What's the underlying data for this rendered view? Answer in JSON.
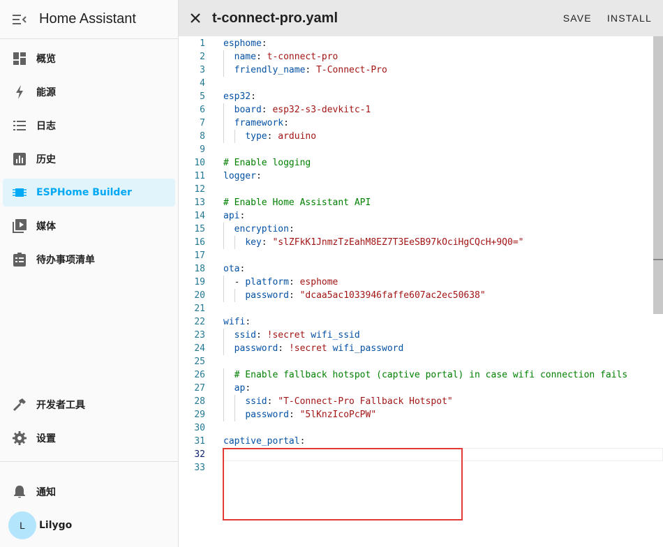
{
  "app": {
    "title": "Home Assistant"
  },
  "sidebar": {
    "items": [
      {
        "label": "概览",
        "icon": "dashboard-icon"
      },
      {
        "label": "能源",
        "icon": "lightning-icon"
      },
      {
        "label": "日志",
        "icon": "list-icon"
      },
      {
        "label": "历史",
        "icon": "chart-icon"
      },
      {
        "label": "ESPHome Builder",
        "icon": "chip-icon",
        "active": true
      },
      {
        "label": "媒体",
        "icon": "play-box-icon"
      },
      {
        "label": "待办事项清单",
        "icon": "clipboard-list-icon"
      }
    ],
    "dev_tools": "开发者工具",
    "settings": "设置",
    "notifications": "通知",
    "user": {
      "name": "Lilygo",
      "initial": "L"
    }
  },
  "editor": {
    "filename": "t-connect-pro.yaml",
    "save_label": "SAVE",
    "install_label": "INSTALL",
    "lines": [
      "esphome:",
      "  name: t-connect-pro",
      "  friendly_name: T-Connect-Pro",
      "",
      "esp32:",
      "  board: esp32-s3-devkitc-1",
      "  framework:",
      "    type: arduino",
      "",
      "# Enable logging",
      "logger:",
      "",
      "# Enable Home Assistant API",
      "api:",
      "  encryption:",
      "    key: \"slZFkK1JnmzTzEahM8EZ7T3EeSB97kOciHgCQcH+9Q0=\"",
      "",
      "ota:",
      "  - platform: esphome",
      "    password: \"dcaa5ac1033946faffe607ac2ec50638\"",
      "",
      "wifi:",
      "  ssid: !secret wifi_ssid",
      "  password: !secret wifi_password",
      "",
      "  # Enable fallback hotspot (captive portal) in case wifi connection fails",
      "  ap:",
      "    ssid: \"T-Connect-Pro Fallback Hotspot\"",
      "    password: \"5lKnzIcoPcPW\"",
      "",
      "captive_portal:",
      "",
      ""
    ]
  },
  "colors": {
    "accent": "#03a9f4",
    "key": "#0451a5",
    "string": "#a31515",
    "comment": "#008000",
    "highlight": "#e53935"
  }
}
